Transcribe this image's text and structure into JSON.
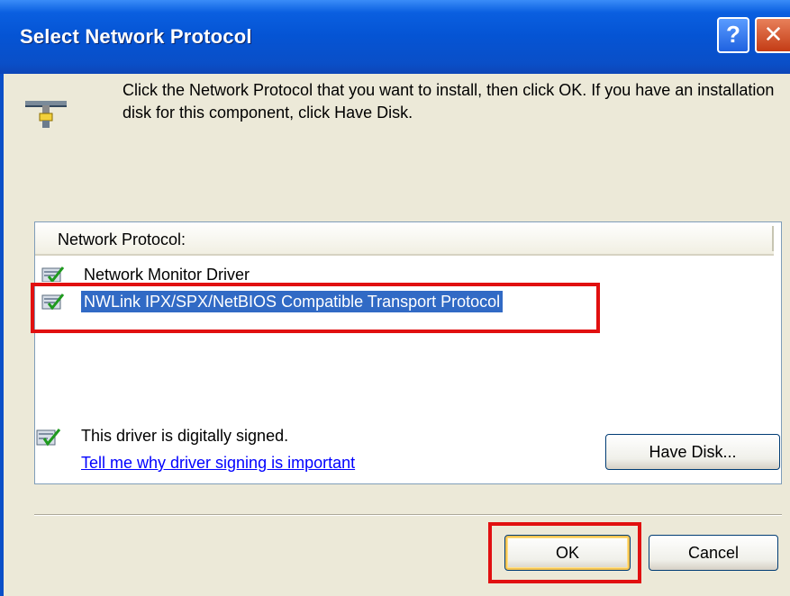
{
  "window": {
    "title": "Select Network Protocol",
    "help_glyph": "?",
    "close_glyph": "✕"
  },
  "instructions": "Click the Network Protocol that you want to install, then click OK. If you have an installation disk for this component, click Have Disk.",
  "list": {
    "header": "Network Protocol:",
    "items": [
      {
        "label": "Network Monitor Driver",
        "icon": "protocol-icon",
        "selected": false
      },
      {
        "label": "NWLink IPX/SPX/NetBIOS Compatible Transport Protocol",
        "icon": "protocol-icon",
        "selected": true
      }
    ]
  },
  "signing": {
    "status": "This driver is digitally signed.",
    "link": "Tell me why driver signing is important",
    "icon": "signed-driver-icon"
  },
  "buttons": {
    "have_disk": "Have Disk...",
    "ok": "OK",
    "cancel": "Cancel"
  },
  "colors": {
    "titlebar": "#0554d4",
    "selection": "#316ac5",
    "highlight_box": "#e11010",
    "link": "#0000ff"
  }
}
